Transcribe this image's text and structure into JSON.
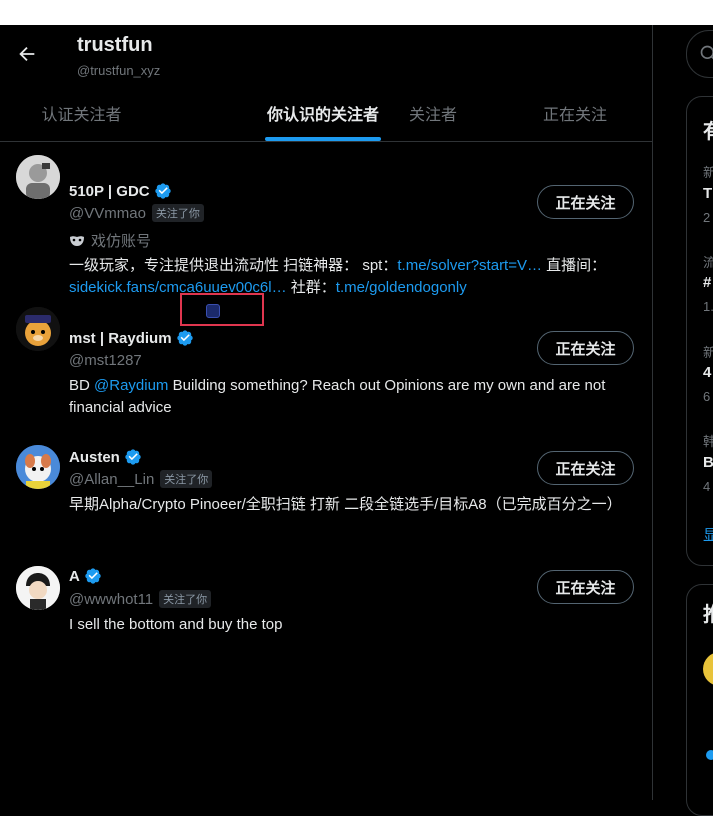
{
  "header": {
    "title": "trustfun",
    "handle": "@trustfun_xyz"
  },
  "tabs": [
    {
      "label": "认证关注者"
    },
    {
      "label": "你认识的关注者"
    },
    {
      "label": "关注者"
    },
    {
      "label": "正在关注"
    }
  ],
  "users": [
    {
      "name": "510P | GDC",
      "handle": "@VVmmao",
      "follows_you": "关注了你",
      "button": "正在关注",
      "impersonation": "戏仿账号",
      "bio": {
        "p1": "一级玩家，专注提供退出流动性 扫链神器： spt：",
        "link1": "t.me/solver?start=V…",
        "p2": " 直播间：",
        "link2": "sidekick.fans/cmca6uuev00c6l…",
        "p3": " 社群：",
        "link3": "t.me/goldendogonly"
      }
    },
    {
      "name": "mst | Raydium",
      "handle": "@mst1287",
      "button": "正在关注",
      "bio": {
        "p1": "BD ",
        "link1": "@Raydium",
        "p2": " Building something? Reach out Opinions are my own and are not financial advice"
      }
    },
    {
      "name": "Austen",
      "handle": "@Allan__Lin",
      "follows_you": "关注了你",
      "button": "正在关注",
      "bio": {
        "p1": "早期Alpha/Crypto Pinoeer/全职扫链 打新 二段全链选手/目标A8（已完成百分之一）"
      }
    },
    {
      "name": "A",
      "handle": "@wwwhot11",
      "follows_you": "关注了你",
      "button": "正在关注",
      "bio": {
        "p1": "I sell the bottom and buy the top"
      }
    }
  ],
  "right_sidebar": {
    "items": [
      {
        "label": "有"
      },
      {
        "label": "新"
      },
      {
        "label": "T"
      },
      {
        "label": "2"
      },
      {
        "label": "流"
      },
      {
        "label": "#"
      },
      {
        "label": "1."
      },
      {
        "label": "新"
      },
      {
        "label": "4"
      },
      {
        "label": "6"
      },
      {
        "label": "韩"
      },
      {
        "label": "B"
      },
      {
        "label": "4"
      },
      {
        "label": "显"
      },
      {
        "label": "推"
      }
    ]
  },
  "colors": {
    "accent": "#1d9bf0",
    "background": "#000000",
    "text": "#e7e9ea",
    "muted": "#71767b",
    "highlight_box": "#e0364f"
  }
}
